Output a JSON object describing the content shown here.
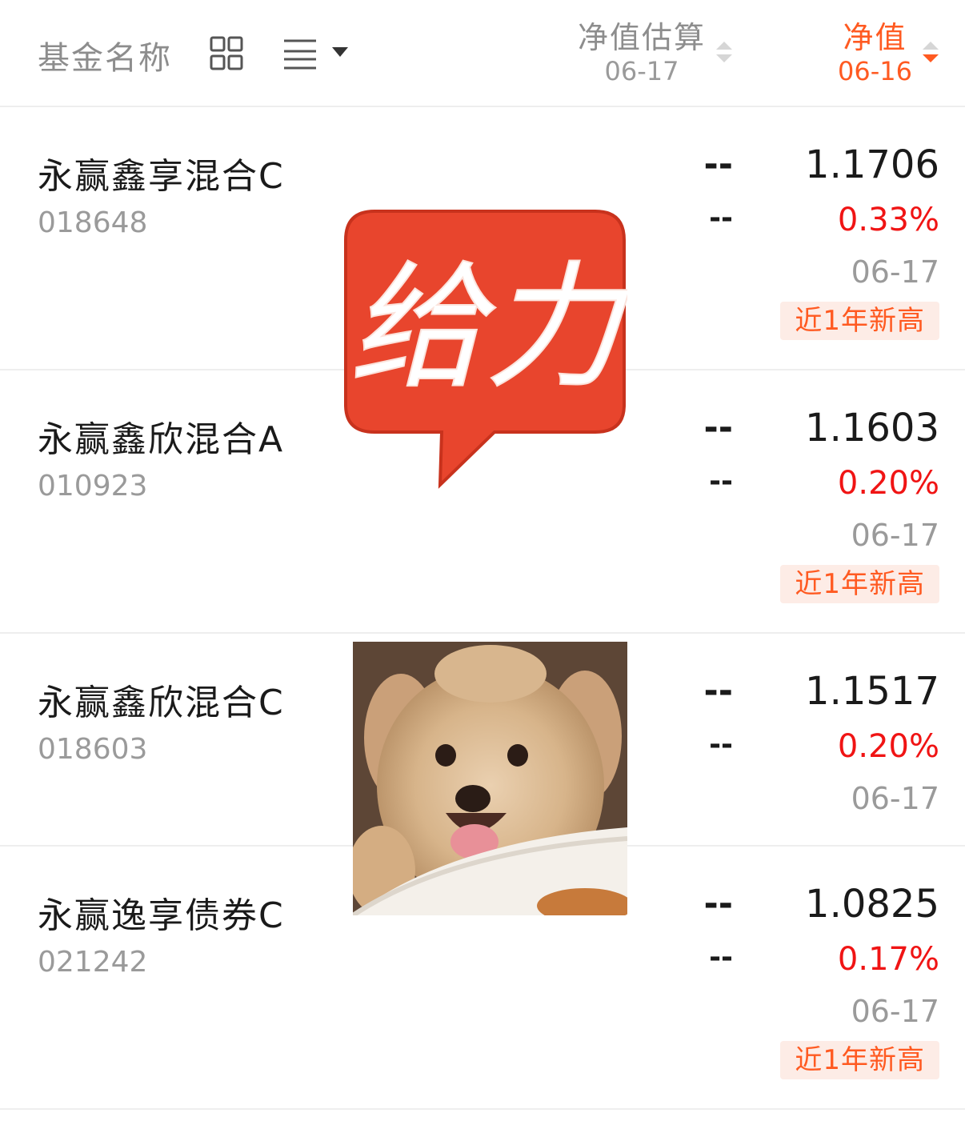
{
  "header": {
    "name_label": "基金名称",
    "est_label": "净值估算",
    "est_date": "06-17",
    "nav_label": "净值",
    "nav_date": "06-16"
  },
  "funds": [
    {
      "name": "永赢鑫享混合C",
      "code": "018648",
      "est_a": "--",
      "est_b": "--",
      "nav": "1.1706",
      "change": "0.33%",
      "date": "06-17",
      "badge": "近1年新高"
    },
    {
      "name": "永赢鑫欣混合A",
      "code": "010923",
      "est_a": "--",
      "est_b": "--",
      "nav": "1.1603",
      "change": "0.20%",
      "date": "06-17",
      "badge": "近1年新高"
    },
    {
      "name": "永赢鑫欣混合C",
      "code": "018603",
      "est_a": "--",
      "est_b": "--",
      "nav": "1.1517",
      "change": "0.20%",
      "date": "06-17"
    },
    {
      "name": "永赢逸享债券C",
      "code": "021242",
      "est_a": "--",
      "est_b": "--",
      "nav": "1.0825",
      "change": "0.17%",
      "date": "06-17",
      "badge": "近1年新高"
    }
  ],
  "stickers": {
    "geili_text": "给力",
    "geili_color": "#e8452d"
  },
  "colors": {
    "accent": "#ff5a21",
    "up": "#f01414"
  }
}
